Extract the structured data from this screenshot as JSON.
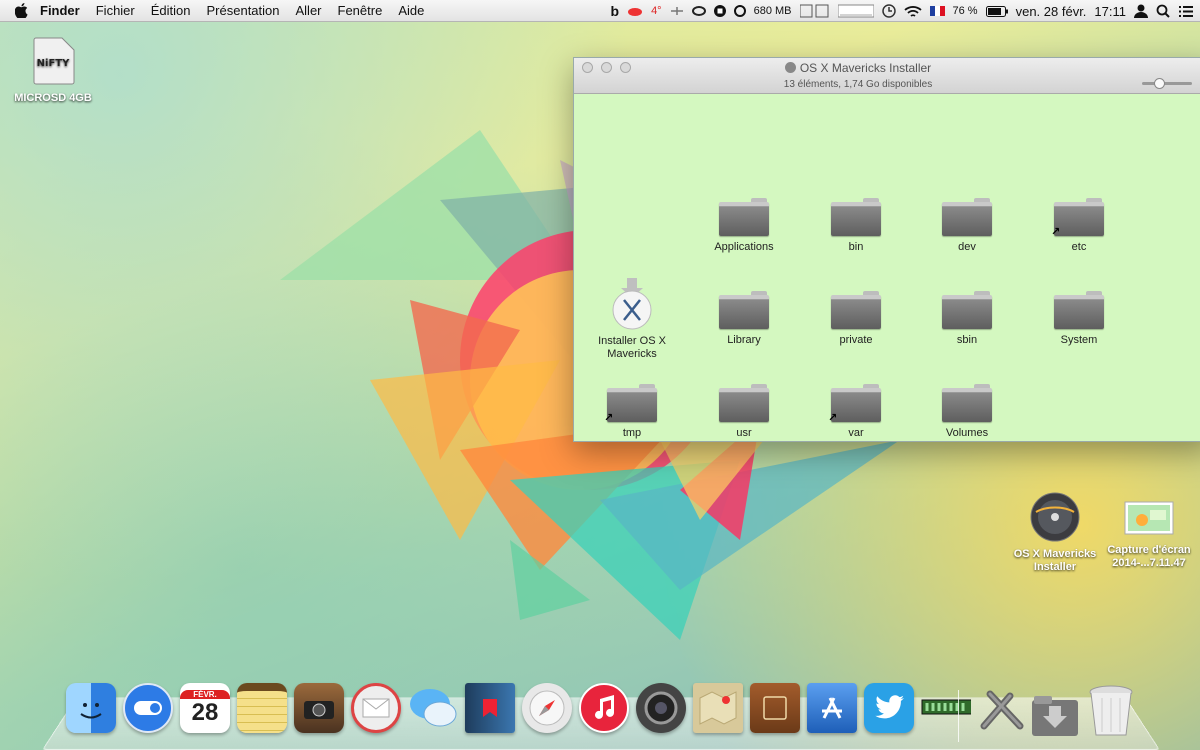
{
  "menubar": {
    "app_name": "Finder",
    "menus": [
      "Fichier",
      "Édition",
      "Présentation",
      "Aller",
      "Fenêtre",
      "Aide"
    ],
    "status": {
      "weather": "4°",
      "memory": "680 MB",
      "battery": "76 %",
      "date": "ven. 28 févr.",
      "time": "17:11"
    }
  },
  "desktop": {
    "drive_label": "MICROSD 4GB",
    "drive_logo_text": "NiFTY",
    "installer_disk_label_1": "OS X Mavericks",
    "installer_disk_label_2": "Installer",
    "screenshot_label_1": "Capture d'écran",
    "screenshot_label_2": "2014-...7.11.47"
  },
  "window": {
    "title": "OS X Mavericks Installer",
    "subtitle": "13 éléments, 1,74 Go disponibles",
    "items": [
      {
        "label": "Applications",
        "alias": false
      },
      {
        "label": "bin",
        "alias": false
      },
      {
        "label": "dev",
        "alias": false
      },
      {
        "label": "etc",
        "alias": true
      },
      {
        "label": "Installer OS X Mavericks",
        "alias": false
      },
      {
        "label": "Library",
        "alias": false
      },
      {
        "label": "private",
        "alias": false
      },
      {
        "label": "sbin",
        "alias": false
      },
      {
        "label": "System",
        "alias": false
      },
      {
        "label": "tmp",
        "alias": true
      },
      {
        "label": "usr",
        "alias": false
      },
      {
        "label": "var",
        "alias": true
      },
      {
        "label": "Volumes",
        "alias": false
      }
    ]
  },
  "dock": {
    "apps": [
      {
        "name": "finder-icon",
        "color": "#3f8ee0"
      },
      {
        "name": "toggle-app-icon",
        "color": "#2d7be6"
      },
      {
        "name": "calendar-icon",
        "color": "#ffffff"
      },
      {
        "name": "notes-icon",
        "color": "#e9c65a"
      },
      {
        "name": "photo-booth-icon",
        "color": "#6b4a2a"
      },
      {
        "name": "mail-icon",
        "color": "#d9d9d9"
      },
      {
        "name": "messages-icon",
        "color": "#48a9f2"
      },
      {
        "name": "ibooks-icon",
        "color": "#2f5e8f"
      },
      {
        "name": "safari-icon",
        "color": "#e5e5e5"
      },
      {
        "name": "itunes-icon",
        "color": "#e8243c"
      },
      {
        "name": "facetime-icon",
        "color": "#444444"
      },
      {
        "name": "maps-icon",
        "color": "#d8c99a"
      },
      {
        "name": "dictionary-icon",
        "color": "#8a4b24"
      },
      {
        "name": "app-store-icon",
        "color": "#2e6fc8"
      },
      {
        "name": "twitter-icon",
        "color": "#2aa1e6"
      },
      {
        "name": "memory-monitor-icon",
        "color": "#3c7c32"
      }
    ],
    "calendar_month": "FÉVR.",
    "calendar_day": "28"
  }
}
